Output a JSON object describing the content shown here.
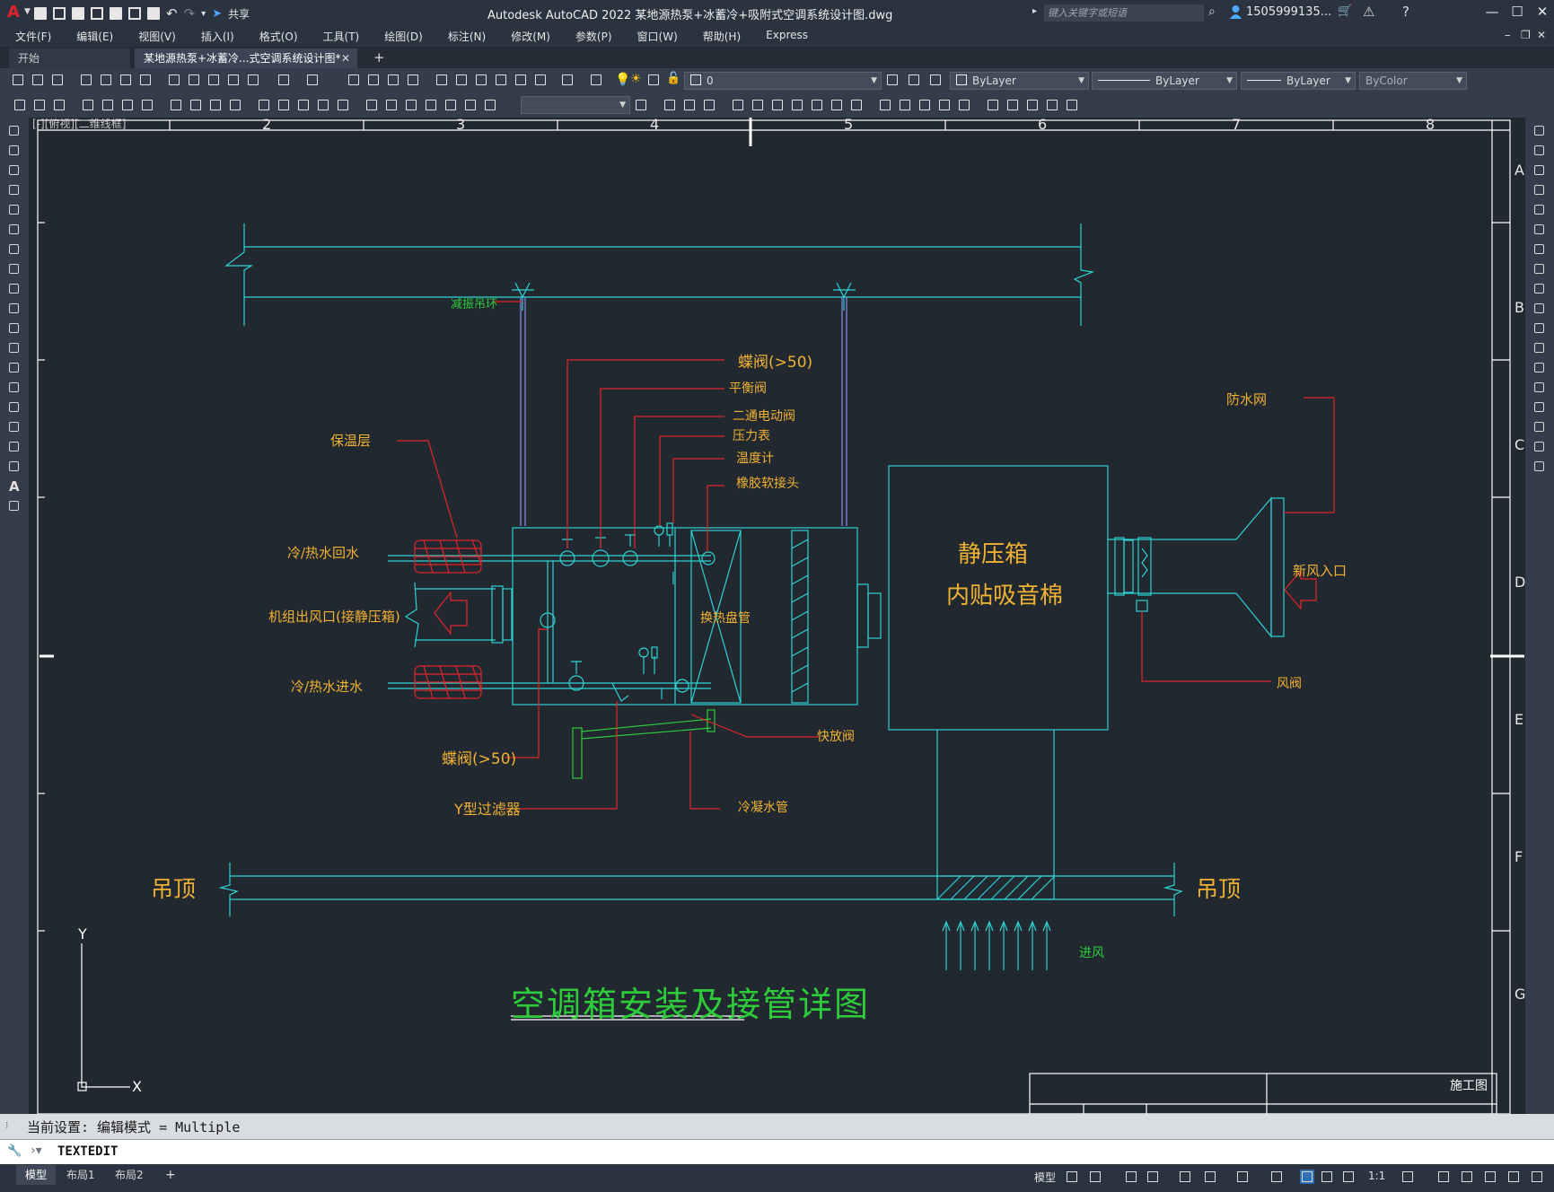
{
  "titlebar": {
    "app_letter": "A",
    "share_label": "共享",
    "title": "Autodesk AutoCAD 2022    某地源热泵+冰蓄冷+吸附式空调系统设计图.dwg",
    "search_placeholder": "键入关键字或短语",
    "user": "1505999135...",
    "minimize": "—",
    "maximize": "☐",
    "close": "✕"
  },
  "menubar": {
    "items": [
      "文件(F)",
      "编辑(E)",
      "视图(V)",
      "插入(I)",
      "格式(O)",
      "工具(T)",
      "绘图(D)",
      "标注(N)",
      "修改(M)",
      "参数(P)",
      "窗口(W)",
      "帮助(H)",
      "Express"
    ]
  },
  "tabs": {
    "start": "开始",
    "file": "某地源热泵+冰蓄冷...式空调系统设计图*",
    "close": "✕",
    "add": "+"
  },
  "properties": {
    "layer_value": "0",
    "color": "ByLayer",
    "linetype": "ByLayer",
    "lineweight": "ByLayer",
    "plotstyle": "ByColor"
  },
  "viewport": {
    "label": "[-][俯视][二维线框]"
  },
  "drawing": {
    "ruler_top": [
      "2",
      "3",
      "4",
      "5",
      "6",
      "7",
      "8"
    ],
    "ruler_right": [
      "A",
      "B",
      "C",
      "D",
      "E",
      "F",
      "G"
    ],
    "labels": {
      "damper_hanger": "减振吊环",
      "butterfly_valve_top": "蝶阀(>50)",
      "balance_valve": "平衡阀",
      "two_way_valve": "二通电动阀",
      "pressure_gauge": "压力表",
      "thermometer": "温度计",
      "rubber_joint": "橡胶软接头",
      "insulation": "保温层",
      "return_water": "冷/热水回水",
      "unit_outlet": "机组出风口(接静压箱)",
      "supply_water": "冷/热水进水",
      "coil": "换热盘管",
      "butterfly_valve_bottom": "蝶阀(>50)",
      "y_filter": "Y型过滤器",
      "quick_drain": "快放阀",
      "condensate": "冷凝水管",
      "plenum_line1": "静压箱",
      "plenum_line2": "内贴吸音棉",
      "rain_screen": "防水网",
      "fresh_air": "新风入口",
      "air_damper": "风阀",
      "ceiling_left": "吊顶",
      "ceiling_right": "吊顶",
      "air_inlet": "进风",
      "drawing_title": "空调箱安装及接管详图",
      "title_block_cell": "施工图",
      "axis_x": "X",
      "axis_y": "Y"
    }
  },
  "command": {
    "history": "当前设置: 编辑模式 = Multiple",
    "input": "TEXTEDIT"
  },
  "statusbar": {
    "tabs": [
      "模型",
      "布局1",
      "布局2"
    ],
    "add": "+",
    "model_label": "模型",
    "scale": "1:1"
  },
  "colors": {
    "cyan": "#2fd3d3",
    "yellow": "#f0b232",
    "red": "#e0252a",
    "green": "#2ecc3a",
    "bg": "#212830"
  }
}
